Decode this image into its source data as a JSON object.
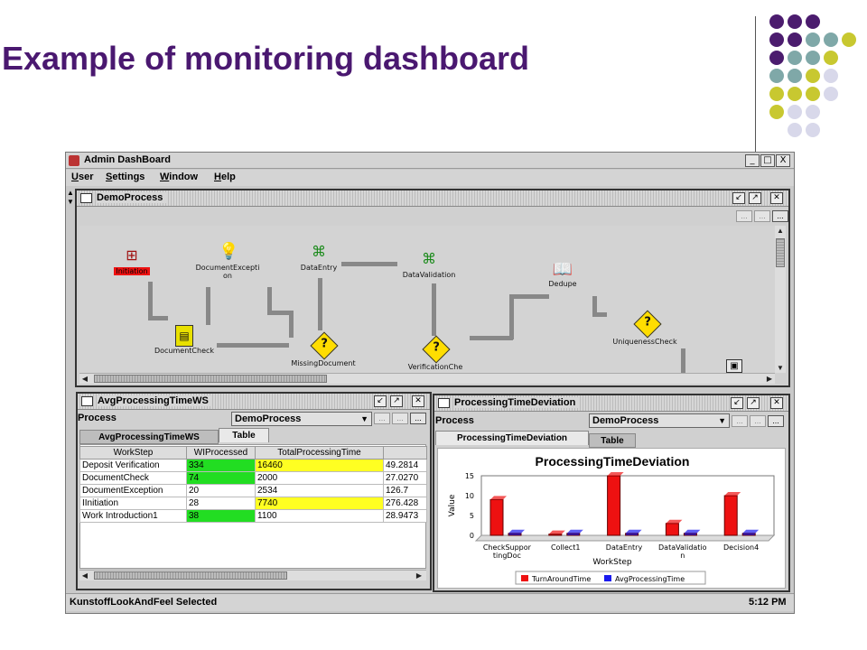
{
  "slide": {
    "title": "Example of monitoring dashboard"
  },
  "app": {
    "title": "Admin DashBoard",
    "window_controls": [
      "_",
      "□",
      "X"
    ],
    "menu": [
      "User",
      "Settings",
      "Window",
      "Help"
    ],
    "status_left": "KunstoffLookAndFeel Selected",
    "status_right": "5:12 PM"
  },
  "process_frame": {
    "title": "DemoProcess",
    "toolbar_buttons": [
      "...",
      "...",
      "..."
    ],
    "nodes": [
      {
        "label": "Initiation",
        "icon": "initiation-icon"
      },
      {
        "label": "DocumentExcepti\non",
        "icon": "lightbulb-icon"
      },
      {
        "label": "DataEntry",
        "icon": "data-entry-icon"
      },
      {
        "label": "DataValidation",
        "icon": "data-validation-icon"
      },
      {
        "label": "Dedupe",
        "icon": "book-icon"
      },
      {
        "label": "DocumentCheck",
        "icon": "document-icon"
      },
      {
        "label": "MissingDocument",
        "icon": "decision-icon"
      },
      {
        "label": "VerificationChe",
        "icon": "decision-icon"
      },
      {
        "label": "UniquenessCheck",
        "icon": "decision-icon"
      }
    ],
    "decision_mark": "?"
  },
  "avg_frame": {
    "title": "AvgProcessingTimeWS",
    "process_label": "Process",
    "process_value": "DemoProcess",
    "tabs": [
      "AvgProcessingTimeWS",
      "Table"
    ],
    "columns": [
      "WorkStep",
      "WIProcessed",
      "TotalProcessingTime",
      ""
    ],
    "rows": [
      [
        "Deposit Verification",
        "334",
        "16460",
        "49.2814"
      ],
      [
        "DocumentCheck",
        "74",
        "2000",
        "27.0270"
      ],
      [
        "DocumentException",
        "20",
        "2534",
        "126.7"
      ],
      [
        "IInitiation",
        "28",
        "7740",
        "276.428"
      ],
      [
        "Work Introduction1",
        "38",
        "1100",
        "28.9473"
      ]
    ],
    "highlight": {
      "green": "#22dd22",
      "yellow": "#ffff22"
    }
  },
  "deviation_frame": {
    "title": "ProcessingTimeDeviation",
    "process_label": "Process",
    "process_value": "DemoProcess",
    "tabs": [
      "ProcessingTimeDeviation",
      "Table"
    ]
  },
  "chart_data": {
    "type": "bar",
    "title": "ProcessingTimeDeviation",
    "xlabel": "WorkStep",
    "ylabel": "Value",
    "categories": [
      "CheckSupportingDoc",
      "Collect1",
      "DataEntry",
      "DataValidation",
      "Decision4"
    ],
    "category_labels": [
      "CheckSuppor\ntingDoc",
      "Collect1",
      "DataEntry",
      "DataValidatio\nn",
      "Decision4"
    ],
    "ylim": [
      0,
      15
    ],
    "yticks": [
      0,
      5,
      10,
      15
    ],
    "series": [
      {
        "name": "TurnAroundTime",
        "values": [
          9,
          0.3,
          15,
          3,
          10
        ],
        "color": "#ee1111"
      },
      {
        "name": "AvgProcessingTime",
        "values": [
          0.5,
          0.5,
          0.5,
          0.5,
          0.5
        ],
        "color": "#1a1aee"
      }
    ],
    "legend_position": "bottom",
    "grid": false
  }
}
